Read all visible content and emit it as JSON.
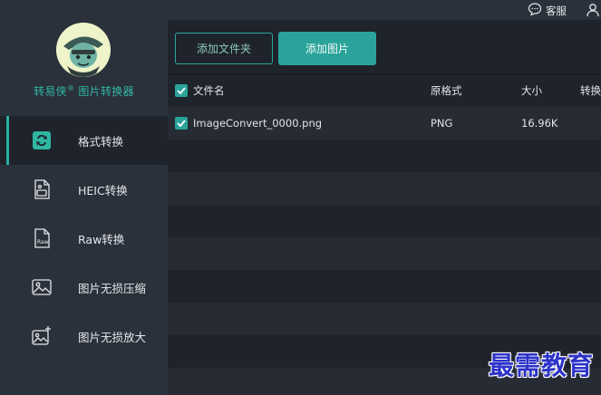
{
  "app": {
    "brand_name": "转易侠",
    "brand_mark": "®",
    "brand_suffix": "图片转换器"
  },
  "topbar": {
    "service_label": "客服",
    "service_icon": "chat-bubble-icon",
    "user_icon": "user-icon"
  },
  "sidebar": {
    "items": [
      {
        "label": "格式转换",
        "icon": "format-convert-icon",
        "active": true
      },
      {
        "label": "HEIC转换",
        "icon": "heic-file-icon",
        "active": false
      },
      {
        "label": "Raw转换",
        "icon": "raw-file-icon",
        "active": false
      },
      {
        "label": "图片无损压缩",
        "icon": "image-compress-icon",
        "active": false
      },
      {
        "label": "图片无损放大",
        "icon": "image-enlarge-icon",
        "active": false
      }
    ]
  },
  "toolbar": {
    "add_folder_label": "添加文件夹",
    "add_image_label": "添加图片"
  },
  "table": {
    "columns": [
      "文件名",
      "原格式",
      "大小",
      "转换"
    ],
    "rows": [
      {
        "name": "ImageConvert_0000.png",
        "format": "PNG",
        "size": "16.96K",
        "checked": true
      }
    ]
  },
  "watermark": "最需教育",
  "colors": {
    "accent": "#2aa39a",
    "sidebar_bg": "#2b313b",
    "content_bg": "#1f232b",
    "watermark": "#2d33c8"
  }
}
